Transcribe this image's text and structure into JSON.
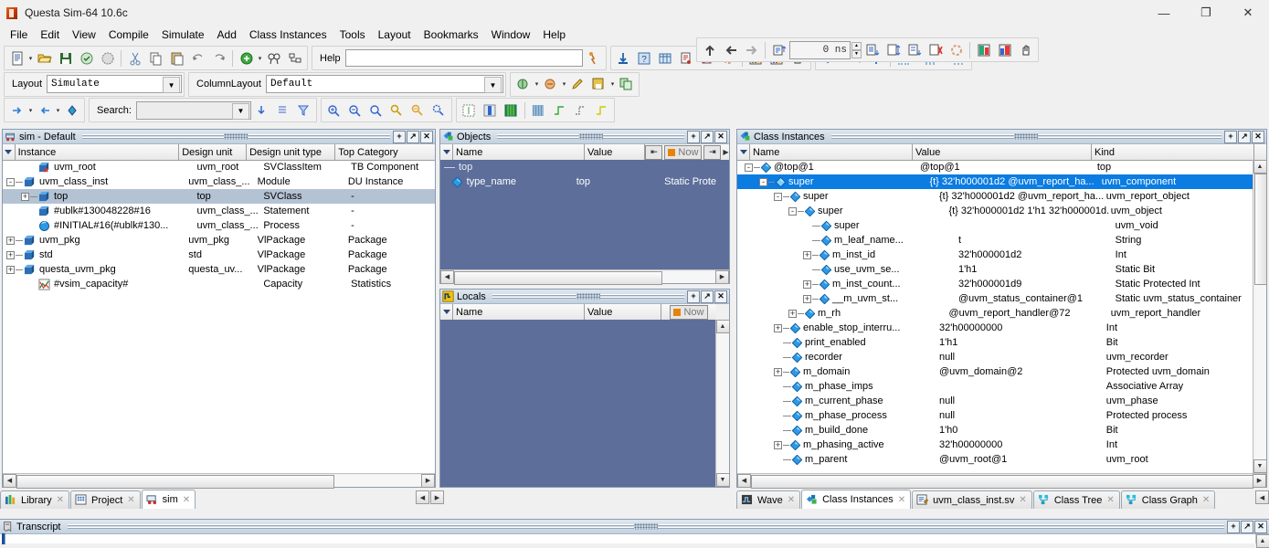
{
  "window": {
    "title": "Questa Sim-64 10.6c",
    "icon": "questa-logo-icon",
    "minimize": "—",
    "maximize": "❐",
    "close": "✕"
  },
  "menubar": {
    "items": [
      "File",
      "Edit",
      "View",
      "Compile",
      "Simulate",
      "Add",
      "Class Instances",
      "Tools",
      "Layout",
      "Bookmarks",
      "Window",
      "Help"
    ]
  },
  "toolbar": {
    "help_label": "Help",
    "help_value": "",
    "layout_label": "Layout",
    "layout_value": "Simulate",
    "columnlayout_label": "ColumnLayout",
    "columnlayout_value": "Default",
    "search_label": "Search:",
    "search_value": "",
    "time_value": "0 ns"
  },
  "sim_pane": {
    "title": "sim - Default",
    "icon": "sim-wagon-icon",
    "buttons": [
      "+",
      "↗",
      "✕"
    ],
    "columns": [
      "Instance",
      "Design unit",
      "Design unit type",
      "Top Category"
    ],
    "rows": [
      {
        "indent": 1,
        "toggle": "",
        "icon": "svclassitem-icon",
        "name": "uvm_root",
        "design_unit": "uvm_root",
        "design_unit_type": "SVClassItem",
        "top_category": "TB Component",
        "selected": false
      },
      {
        "indent": 0,
        "toggle": "-",
        "icon": "module-icon",
        "name": "uvm_class_inst",
        "design_unit": "uvm_class_...",
        "design_unit_type": "Module",
        "top_category": "DU Instance",
        "selected": false
      },
      {
        "indent": 1,
        "toggle": "+",
        "icon": "module-icon",
        "name": "top",
        "design_unit": "top",
        "design_unit_type": "SVClass",
        "top_category": "-",
        "selected": true
      },
      {
        "indent": 1,
        "toggle": "",
        "icon": "module-icon",
        "name": "#ublk#130048228#16",
        "design_unit": "uvm_class_...",
        "design_unit_type": "Statement",
        "top_category": "-",
        "selected": false
      },
      {
        "indent": 1,
        "toggle": "",
        "icon": "process-icon",
        "name": "#INITIAL#16(#ublk#130...",
        "design_unit": "uvm_class_...",
        "design_unit_type": "Process",
        "top_category": "-",
        "selected": false
      },
      {
        "indent": 0,
        "toggle": "+",
        "icon": "module-icon",
        "name": "uvm_pkg",
        "design_unit": "uvm_pkg",
        "design_unit_type": "VlPackage",
        "top_category": "Package",
        "selected": false
      },
      {
        "indent": 0,
        "toggle": "+",
        "icon": "module-icon",
        "name": "std",
        "design_unit": "std",
        "design_unit_type": "VlPackage",
        "top_category": "Package",
        "selected": false
      },
      {
        "indent": 0,
        "toggle": "+",
        "icon": "module-icon",
        "name": "questa_uvm_pkg",
        "design_unit": "questa_uv...",
        "design_unit_type": "VlPackage",
        "top_category": "Package",
        "selected": false
      },
      {
        "indent": 1,
        "toggle": "",
        "icon": "capacity-icon",
        "name": "#vsim_capacity#",
        "design_unit": "",
        "design_unit_type": "Capacity",
        "top_category": "Statistics",
        "selected": false
      }
    ]
  },
  "objects_pane": {
    "title": "Objects",
    "icon": "objects-icon",
    "buttons": [
      "+",
      "↗",
      "✕"
    ],
    "columns": [
      "Name",
      "Value"
    ],
    "now_label": "Now",
    "group_label": "top",
    "rows": [
      {
        "icon": "diamond-icon",
        "name": "type_name",
        "value": "top",
        "kind": "Static Prote"
      }
    ]
  },
  "locals_pane": {
    "title": "Locals",
    "icon": "locals-icon",
    "buttons": [
      "+",
      "↗",
      "✕"
    ],
    "columns": [
      "Name",
      "Value"
    ],
    "now_label": "Now",
    "rows": []
  },
  "class_instances_pane": {
    "title": "Class Instances",
    "icon": "class-instances-icon",
    "buttons": [
      "+",
      "↗",
      "✕"
    ],
    "columns": [
      "Name",
      "Value",
      "Kind"
    ],
    "rows": [
      {
        "indent": 0,
        "toggle": "-",
        "name": "@top@1",
        "value": "@top@1",
        "kind": "top",
        "selected": false
      },
      {
        "indent": 1,
        "toggle": "-",
        "name": "super",
        "value": "{t} 32'h000001d2 @uvm_report_ha...",
        "kind": "uvm_component",
        "selected": true
      },
      {
        "indent": 2,
        "toggle": "-",
        "name": "super",
        "value": "{t} 32'h000001d2 @uvm_report_ha...",
        "kind": "uvm_report_object",
        "selected": false
      },
      {
        "indent": 3,
        "toggle": "-",
        "name": "super",
        "value": "{t} 32'h000001d2 1'h1 32'h000001d...",
        "kind": "uvm_object",
        "selected": false
      },
      {
        "indent": 4,
        "toggle": "",
        "name": "super",
        "value": "",
        "kind": "uvm_void",
        "selected": false
      },
      {
        "indent": 4,
        "toggle": "",
        "name": "m_leaf_name...",
        "value": "t",
        "kind": "String",
        "selected": false
      },
      {
        "indent": 4,
        "toggle": "+",
        "name": "m_inst_id",
        "value": "32'h000001d2",
        "kind": "Int",
        "selected": false
      },
      {
        "indent": 4,
        "toggle": "",
        "name": "use_uvm_se...",
        "value": "1'h1",
        "kind": "Static Bit",
        "selected": false
      },
      {
        "indent": 4,
        "toggle": "+",
        "name": "m_inst_count...",
        "value": "32'h000001d9",
        "kind": "Static Protected Int",
        "selected": false
      },
      {
        "indent": 4,
        "toggle": "+",
        "name": "__m_uvm_st...",
        "value": "@uvm_status_container@1",
        "kind": "Static uvm_status_container",
        "selected": false
      },
      {
        "indent": 3,
        "toggle": "+",
        "name": "m_rh",
        "value": "@uvm_report_handler@72",
        "kind": "uvm_report_handler",
        "selected": false
      },
      {
        "indent": 2,
        "toggle": "+",
        "name": "enable_stop_interru...",
        "value": "32'h00000000",
        "kind": "Int",
        "selected": false
      },
      {
        "indent": 2,
        "toggle": "",
        "name": "print_enabled",
        "value": "1'h1",
        "kind": "Bit",
        "selected": false
      },
      {
        "indent": 2,
        "toggle": "",
        "name": "recorder",
        "value": "null",
        "kind": "uvm_recorder",
        "selected": false
      },
      {
        "indent": 2,
        "toggle": "+",
        "name": "m_domain",
        "value": "@uvm_domain@2",
        "kind": "Protected uvm_domain",
        "selected": false
      },
      {
        "indent": 2,
        "toggle": "",
        "name": "m_phase_imps",
        "value": "",
        "kind": "Associative Array",
        "selected": false
      },
      {
        "indent": 2,
        "toggle": "",
        "name": "m_current_phase",
        "value": "null",
        "kind": "uvm_phase",
        "selected": false
      },
      {
        "indent": 2,
        "toggle": "",
        "name": "m_phase_process",
        "value": "null",
        "kind": "Protected process",
        "selected": false
      },
      {
        "indent": 2,
        "toggle": "",
        "name": "m_build_done",
        "value": "1'h0",
        "kind": "Bit",
        "selected": false
      },
      {
        "indent": 2,
        "toggle": "+",
        "name": "m_phasing_active",
        "value": "32'h00000000",
        "kind": "Int",
        "selected": false
      },
      {
        "indent": 2,
        "toggle": "",
        "name": "m_parent",
        "value": "@uvm_root@1",
        "kind": "uvm_root",
        "selected": false
      }
    ]
  },
  "left_tabs": {
    "items": [
      {
        "label": "Library",
        "icon": "library-icon",
        "active": false
      },
      {
        "label": "Project",
        "icon": "project-icon",
        "active": false
      },
      {
        "label": "sim",
        "icon": "sim-wagon-icon",
        "active": true
      }
    ]
  },
  "right_tabs": {
    "items": [
      {
        "label": "Wave",
        "icon": "wave-icon",
        "active": false
      },
      {
        "label": "Class Instances",
        "icon": "class-instances-icon",
        "active": true
      },
      {
        "label": "uvm_class_inst.sv",
        "icon": "source-file-icon",
        "active": false
      },
      {
        "label": "Class Tree",
        "icon": "class-tree-icon",
        "active": false
      },
      {
        "label": "Class Graph",
        "icon": "class-graph-icon",
        "active": false
      }
    ]
  },
  "transcript_pane": {
    "title": "Transcript",
    "icon": "transcript-icon",
    "buttons": [
      "+",
      "↗",
      "✕"
    ]
  },
  "colors": {
    "selection_blue": "#0a7ce2",
    "selection_grey": "#b4c3d4",
    "objects_bg": "#5c6e99",
    "pane_title": "#c3d1e0",
    "window_bg": "#f0f0f0"
  }
}
